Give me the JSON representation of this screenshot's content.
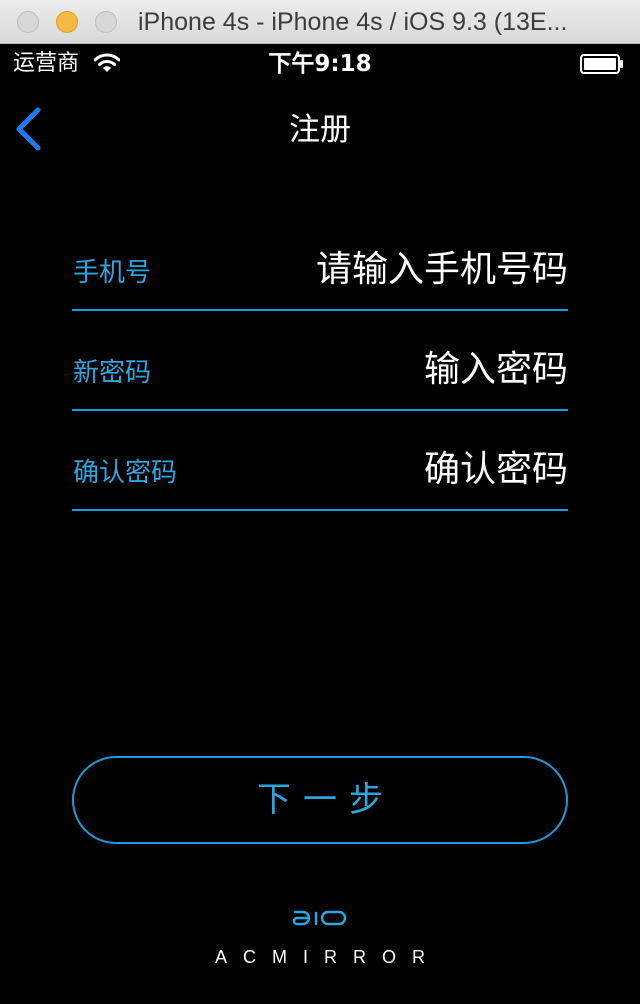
{
  "window": {
    "title": "iPhone 4s - iPhone 4s / iOS 9.3 (13E..."
  },
  "status_bar": {
    "carrier": "运营商",
    "time": "下午9:18",
    "battery_level": 1.0
  },
  "nav": {
    "title": "注册",
    "back_icon": "chevron-left-icon"
  },
  "form": {
    "phone": {
      "label": "手机号",
      "placeholder": "请输入手机号码",
      "value": ""
    },
    "new_password": {
      "label": "新密码",
      "placeholder": "输入密码",
      "value": ""
    },
    "confirm_password": {
      "label": "确认密码",
      "placeholder": "确认密码",
      "value": ""
    }
  },
  "next_button": {
    "label": "下一步"
  },
  "footer": {
    "logo_mark": "aio",
    "wordmark": "ACMIRROR"
  },
  "colors": {
    "background": "#000000",
    "accent": "#1e9ad6",
    "label": "#2aa6e0",
    "back_icon": "#1a7cf2",
    "text": "#ffffff"
  }
}
